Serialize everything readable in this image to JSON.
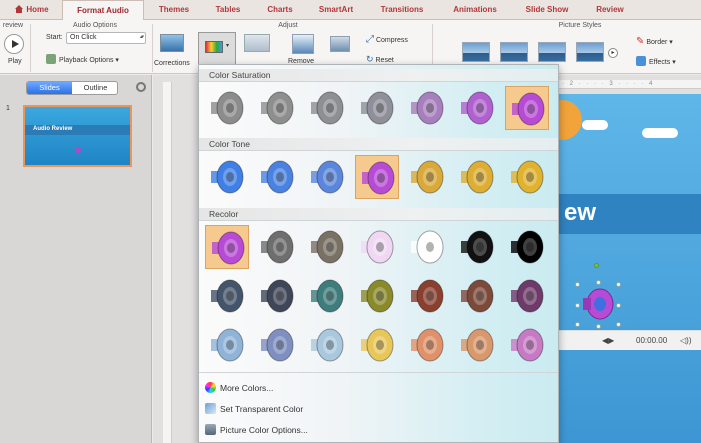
{
  "ribbon": {
    "tabs": [
      {
        "label": "Home",
        "active": false
      },
      {
        "label": "Format Audio",
        "active": true
      },
      {
        "label": "Themes",
        "active": false
      },
      {
        "label": "Tables",
        "active": false
      },
      {
        "label": "Charts",
        "active": false
      },
      {
        "label": "SmartArt",
        "active": false
      },
      {
        "label": "Transitions",
        "active": false
      },
      {
        "label": "Animations",
        "active": false
      },
      {
        "label": "Slide Show",
        "active": false
      },
      {
        "label": "Review",
        "active": false
      }
    ],
    "groups": {
      "preview": "review",
      "audio_options": "Audio Options",
      "adjust": "Adjust",
      "picture_styles": "Picture Styles"
    },
    "play_label": "Play",
    "start_label": "Start:",
    "start_value": "On Click",
    "playback_options": "Playback Options",
    "corrections": "Corrections",
    "remove": "Remove",
    "compress": "Compress",
    "reset": "Reset",
    "border": "Border",
    "effects": "Effects"
  },
  "slides_pane": {
    "tab_slides": "Slides",
    "tab_outline": "Outline",
    "slide_number": "1",
    "thumb_title": "Audio Review"
  },
  "slide": {
    "title_fragment": "ew",
    "player_time": "00:00.00"
  },
  "gallery": {
    "sections": [
      {
        "title": "Color Saturation",
        "swatches": [
          {
            "color": "#8c8c8c",
            "selected": false
          },
          {
            "color": "#8e8e8e",
            "selected": false
          },
          {
            "color": "#8d8f92",
            "selected": false
          },
          {
            "color": "#8e8f99",
            "selected": false
          },
          {
            "color": "#a77fbd",
            "selected": false
          },
          {
            "color": "#b060cf",
            "selected": false
          },
          {
            "color": "#b84bd6",
            "selected": true
          }
        ]
      },
      {
        "title": "Color Tone",
        "swatches": [
          {
            "color": "#3f7fe6",
            "selected": false
          },
          {
            "color": "#4a82e2",
            "selected": false
          },
          {
            "color": "#5a86dc",
            "selected": false
          },
          {
            "color": "#b84bd6",
            "selected": true
          },
          {
            "color": "#d9a93a",
            "selected": false
          },
          {
            "color": "#ddae33",
            "selected": false
          },
          {
            "color": "#e0b22e",
            "selected": false
          }
        ]
      },
      {
        "title": "Recolor",
        "swatches": [
          {
            "color": "#b84bd6",
            "selected": true
          },
          {
            "color": "#6e6e6e",
            "selected": false
          },
          {
            "color": "#7a7165",
            "selected": false
          },
          {
            "color": "#f0d8f4",
            "selected": false
          },
          {
            "color": "#ffffff",
            "selected": false
          },
          {
            "color": "#111111",
            "selected": false
          },
          {
            "color": "#000000",
            "selected": false
          },
          {
            "color": "#44546a",
            "selected": false
          },
          {
            "color": "#3e4658",
            "selected": false
          },
          {
            "color": "#3e7d7c",
            "selected": false
          },
          {
            "color": "#8a8a2a",
            "selected": false
          },
          {
            "color": "#8a3f2f",
            "selected": false
          },
          {
            "color": "#7d4a3a",
            "selected": false
          },
          {
            "color": "#6e3a6a",
            "selected": false
          },
          {
            "color": "#8fb4d8",
            "selected": false
          },
          {
            "color": "#7e8fc0",
            "selected": false
          },
          {
            "color": "#a9c8dd",
            "selected": false
          },
          {
            "color": "#e8c75a",
            "selected": false
          },
          {
            "color": "#e0916a",
            "selected": false
          },
          {
            "color": "#d9976c",
            "selected": false
          },
          {
            "color": "#c77ac4",
            "selected": false
          }
        ]
      }
    ],
    "menu_items": [
      {
        "label": "More Colors...",
        "icon": "color-wheel-icon"
      },
      {
        "label": "Set Transparent Color",
        "icon": "transparent-color-icon"
      },
      {
        "label": "Picture Color Options...",
        "icon": "picture-options-icon"
      }
    ]
  },
  "colors": {
    "accent": "#b0383b",
    "selection": "#f6c98f",
    "slide_blue": "#3d96d3"
  }
}
